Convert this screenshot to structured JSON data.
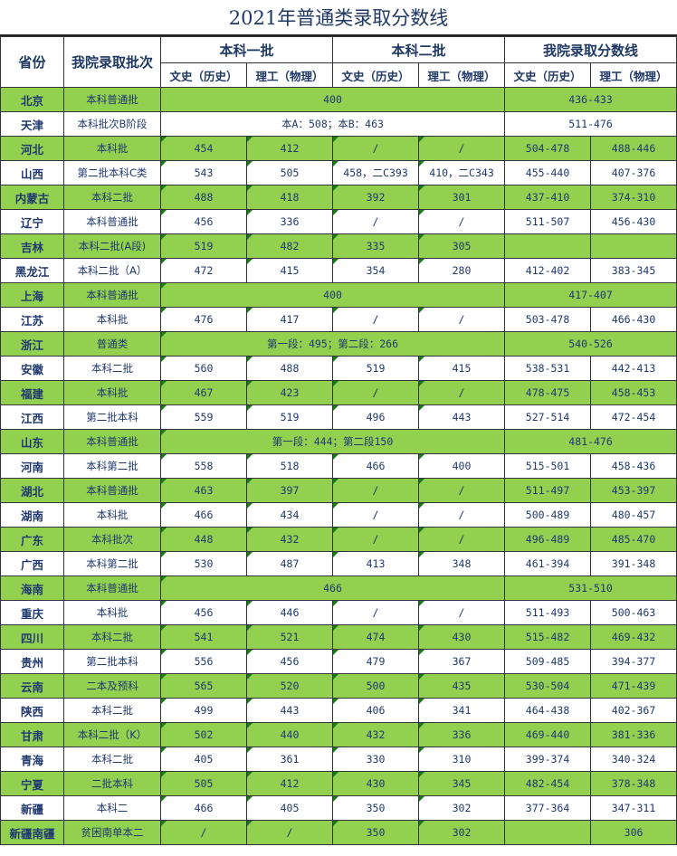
{
  "title": "2021年普通类录取分数线",
  "headers": {
    "province": "省份",
    "batch": "我院录取批次",
    "group1": "本科一批",
    "group2": "本科二批",
    "group3": "我院录取分数线",
    "sub_wen": "文史（历史）",
    "sub_li": "理工（物理）"
  },
  "colors": {
    "green_row": "#92d050",
    "white_row": "#ffffff",
    "text": "#1f3870"
  },
  "rows": [
    {
      "province": "北京",
      "batch": "本科普通批",
      "merged1": "400",
      "merged3": "436-433"
    },
    {
      "province": "天津",
      "batch": "本科批次B阶段",
      "merged1": "本A：508；本B：463",
      "merged3": "511-476"
    },
    {
      "province": "河北",
      "batch": "本科批",
      "v": [
        "454",
        "412",
        "/",
        "/",
        "504-478",
        "488-446"
      ]
    },
    {
      "province": "山西",
      "batch": "第二批本科C类",
      "v": [
        "543",
        "505",
        "458，二C393",
        "410，二C343",
        "455-440",
        "407-376"
      ]
    },
    {
      "province": "内蒙古",
      "batch": "本科二批",
      "v": [
        "488",
        "418",
        "392",
        "301",
        "437-410",
        "374-310"
      ]
    },
    {
      "province": "辽宁",
      "batch": "本科普通批",
      "v": [
        "456",
        "336",
        "/",
        "/",
        "511-507",
        "456-430"
      ]
    },
    {
      "province": "吉林",
      "batch": "本科二批(A段)",
      "v": [
        "519",
        "482",
        "335",
        "305",
        "",
        ""
      ]
    },
    {
      "province": "黑龙江",
      "batch": "本科二批（A）",
      "v": [
        "472",
        "415",
        "354",
        "280",
        "412-402",
        "383-345"
      ]
    },
    {
      "province": "上海",
      "batch": "本科普通批",
      "merged1": "400",
      "merged3": "417-407"
    },
    {
      "province": "江苏",
      "batch": "本科批",
      "v": [
        "476",
        "417",
        "/",
        "/",
        "503-478",
        "466-430"
      ]
    },
    {
      "province": "浙江",
      "batch": "普通类",
      "merged1": "第一段：495；第二段：266",
      "merged3": "540-526"
    },
    {
      "province": "安徽",
      "batch": "本科二批",
      "v": [
        "560",
        "488",
        "519",
        "415",
        "538-531",
        "442-413"
      ]
    },
    {
      "province": "福建",
      "batch": "本科批",
      "v": [
        "467",
        "423",
        "/",
        "/",
        "478-475",
        "458-453"
      ]
    },
    {
      "province": "江西",
      "batch": "第二批本科",
      "v": [
        "559",
        "519",
        "496",
        "443",
        "527-514",
        "472-454"
      ]
    },
    {
      "province": "山东",
      "batch": "本科普通批",
      "merged1": "第一段：444；第二段150",
      "merged3": "481-476"
    },
    {
      "province": "河南",
      "batch": "本科第二批",
      "v": [
        "558",
        "518",
        "466",
        "400",
        "515-501",
        "458-436"
      ]
    },
    {
      "province": "湖北",
      "batch": "本科普通批",
      "v": [
        "463",
        "397",
        "/",
        "/",
        "511-497",
        "453-397"
      ]
    },
    {
      "province": "湖南",
      "batch": "本科批",
      "v": [
        "466",
        "434",
        "/",
        "/",
        "500-489",
        "480-457"
      ]
    },
    {
      "province": "广东",
      "batch": "本科批次",
      "v": [
        "448",
        "432",
        "/",
        "/",
        "496-489",
        "485-470"
      ]
    },
    {
      "province": "广西",
      "batch": "本科第二批",
      "v": [
        "530",
        "487",
        "413",
        "348",
        "461-394",
        "391-348"
      ]
    },
    {
      "province": "海南",
      "batch": "本科普通批",
      "merged1": "466",
      "merged3": "531-510"
    },
    {
      "province": "重庆",
      "batch": "本科批",
      "v": [
        "456",
        "446",
        "/",
        "/",
        "511-493",
        "500-463"
      ]
    },
    {
      "province": "四川",
      "batch": "本科二批",
      "v": [
        "541",
        "521",
        "474",
        "430",
        "515-482",
        "469-432"
      ]
    },
    {
      "province": "贵州",
      "batch": "第二批本科",
      "v": [
        "556",
        "456",
        "479",
        "367",
        "509-485",
        "394-377"
      ]
    },
    {
      "province": "云南",
      "batch": "二本及预科",
      "v": [
        "565",
        "520",
        "500",
        "435",
        "530-504",
        "471-439"
      ]
    },
    {
      "province": "陕西",
      "batch": "本科二批",
      "v": [
        "499",
        "443",
        "406",
        "341",
        "464-438",
        "402-367"
      ]
    },
    {
      "province": "甘肃",
      "batch": "本科二批（K）",
      "v": [
        "502",
        "440",
        "432",
        "336",
        "469-440",
        "381-336"
      ]
    },
    {
      "province": "青海",
      "batch": "本科二批",
      "v": [
        "405",
        "361",
        "330",
        "310",
        "399-374",
        "340-324"
      ]
    },
    {
      "province": "宁夏",
      "batch": "二批本科",
      "v": [
        "505",
        "412",
        "430",
        "345",
        "482-454",
        "378-348"
      ]
    },
    {
      "province": "新疆",
      "batch": "本科二",
      "v": [
        "466",
        "405",
        "350",
        "302",
        "377-364",
        "347-311"
      ]
    },
    {
      "province": "新疆南疆",
      "batch": "贫困南单本二",
      "v": [
        "/",
        "/",
        "350",
        "302",
        "",
        "306"
      ]
    }
  ]
}
